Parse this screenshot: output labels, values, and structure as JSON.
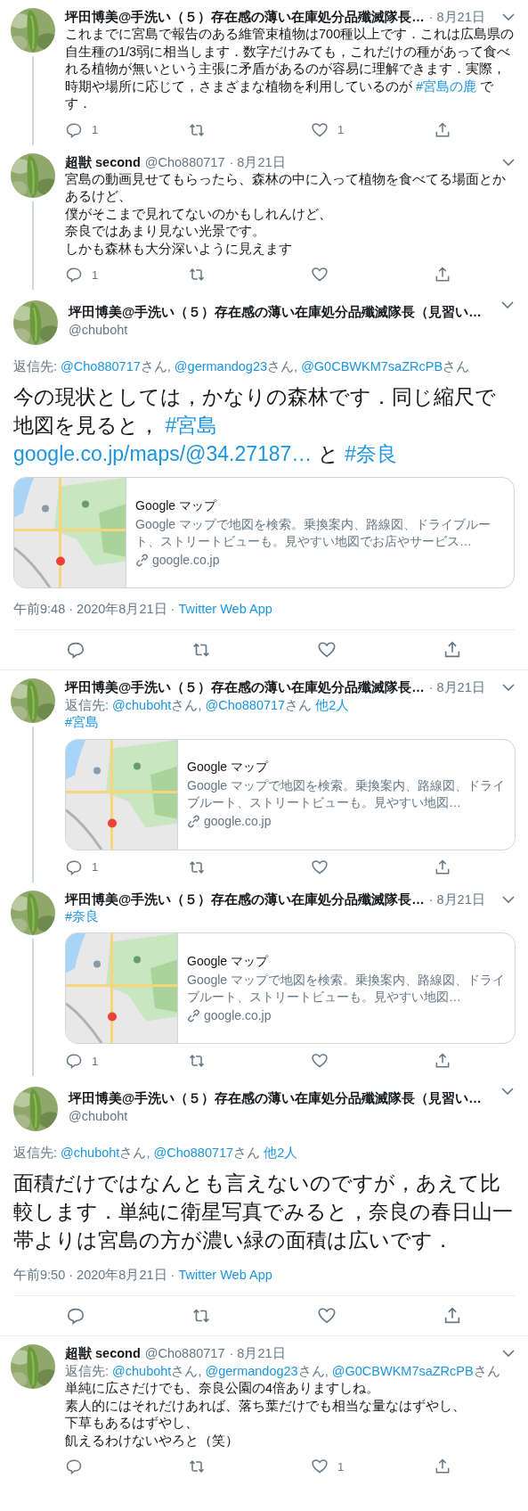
{
  "tweets": [
    {
      "kind": "reply",
      "connected": true,
      "name": "坪田博美@手洗い（５）存在感の薄い在庫処分品殲滅隊長…",
      "date": "· 8月21日",
      "body": [
        [
          {
            "kind": "text",
            "text": "これまでに宮島で報告のある維管束植物は700種以上です．これは広島県の自生種の1/3弱に相当します．数字だけみても，これだけの種があって食べれる植物が無いという主張に矛盾があるのが容易に理解できます．実際，時期や場所に応じて，さまざまな植物を利用しているのが "
          },
          {
            "kind": "link",
            "text": "#宮島の鹿"
          },
          {
            "kind": "text",
            "text": " です．"
          }
        ]
      ],
      "actions": [
        {
          "kind": "reply",
          "count": "1"
        },
        {
          "kind": "retweet"
        },
        {
          "kind": "like",
          "count": "1"
        },
        {
          "kind": "share"
        }
      ]
    },
    {
      "kind": "reply",
      "connected": true,
      "name": "超獣 second",
      "handle": "@Cho880717",
      "date": "· 8月21日",
      "body": [
        [
          {
            "kind": "text",
            "text": "宮島の動画見せてもらったら、森林の中に入って植物を食べてる場面とかあるけど、"
          }
        ],
        [
          {
            "kind": "text",
            "text": "僕がそこまで見れてないのかもしれんけど、"
          }
        ],
        [
          {
            "kind": "text",
            "text": "奈良ではあまり見ない光景です。"
          }
        ],
        [
          {
            "kind": "text",
            "text": "しかも森林も大分深いように見えます"
          }
        ]
      ],
      "actions": [
        {
          "kind": "reply",
          "count": "1"
        },
        {
          "kind": "retweet"
        },
        {
          "kind": "like"
        },
        {
          "kind": "share"
        }
      ]
    },
    {
      "kind": "focused",
      "name": "坪田博美@手洗い（５）存在感の薄い在庫処分品殲滅隊長（見習い…",
      "handle": "@chuboht",
      "reply_to": [
        {
          "kind": "text",
          "text": "返信先: "
        },
        {
          "kind": "link",
          "text": "@Cho880717"
        },
        {
          "kind": "text",
          "text": "さん, "
        },
        {
          "kind": "link",
          "text": "@germandog23"
        },
        {
          "kind": "text",
          "text": "さん, "
        },
        {
          "kind": "link",
          "text": "@G0CBWKM7saZRcPB"
        },
        {
          "kind": "text",
          "text": "さん"
        }
      ],
      "body": [
        [
          {
            "kind": "text",
            "text": "今の現状としては，かなりの森林です．同じ縮尺で地図を見ると， "
          },
          {
            "kind": "link",
            "text": "#宮島"
          }
        ],
        [
          {
            "kind": "link",
            "text": "google.co.jp/maps/@34.27187…"
          },
          {
            "kind": "text",
            "text": " と "
          },
          {
            "kind": "link",
            "text": "#奈良"
          }
        ]
      ],
      "card": {
        "title": "Google マップ",
        "description": "Google マップで地図を検索。乗換案内、路線図、ドライブルート、ストリートビューも。見やすい地図でお店やサービス…",
        "domain": "google.co.jp"
      },
      "meta": {
        "time": "午前9:48 · 2020年8月21日 · ",
        "source": "Twitter Web App"
      },
      "actions": [
        {
          "kind": "reply"
        },
        {
          "kind": "retweet"
        },
        {
          "kind": "like"
        },
        {
          "kind": "share"
        }
      ]
    },
    {
      "kind": "reply",
      "connected": true,
      "name": "坪田博美@手洗い（５）存在感の薄い在庫処分品殲滅隊長…",
      "date": "· 8月21日",
      "reply_to": [
        {
          "kind": "text",
          "text": "返信先: "
        },
        {
          "kind": "link",
          "text": "@chuboht"
        },
        {
          "kind": "text",
          "text": "さん, "
        },
        {
          "kind": "link",
          "text": "@Cho880717"
        },
        {
          "kind": "text",
          "text": "さん "
        },
        {
          "kind": "link",
          "text": "他2人"
        }
      ],
      "body": [
        [
          {
            "kind": "link",
            "text": "#宮島"
          }
        ]
      ],
      "card": {
        "title": "Google マップ",
        "description": "Google マップで地図を検索。乗換案内、路線図、ドライブルート、ストリートビューも。見やすい地図…",
        "domain": "google.co.jp"
      },
      "actions": [
        {
          "kind": "reply",
          "count": "1"
        },
        {
          "kind": "retweet"
        },
        {
          "kind": "like"
        },
        {
          "kind": "share"
        }
      ]
    },
    {
      "kind": "reply",
      "connected": true,
      "name": "坪田博美@手洗い（５）存在感の薄い在庫処分品殲滅隊長…",
      "date": "· 8月21日",
      "body": [
        [
          {
            "kind": "link",
            "text": "#奈良"
          }
        ]
      ],
      "card": {
        "title": "Google マップ",
        "description": "Google マップで地図を検索。乗換案内、路線図、ドライブルート、ストリートビューも。見やすい地図…",
        "domain": "google.co.jp"
      },
      "actions": [
        {
          "kind": "reply",
          "count": "1"
        },
        {
          "kind": "retweet"
        },
        {
          "kind": "like"
        },
        {
          "kind": "share"
        }
      ]
    },
    {
      "kind": "focused",
      "name": "坪田博美@手洗い（５）存在感の薄い在庫処分品殲滅隊長（見習い…",
      "handle": "@chuboht",
      "reply_to": [
        {
          "kind": "text",
          "text": "返信先: "
        },
        {
          "kind": "link",
          "text": "@chuboht"
        },
        {
          "kind": "text",
          "text": "さん, "
        },
        {
          "kind": "link",
          "text": "@Cho880717"
        },
        {
          "kind": "text",
          "text": "さん "
        },
        {
          "kind": "link",
          "text": "他2人"
        }
      ],
      "body": [
        [
          {
            "kind": "text",
            "text": "面積だけではなんとも言えないのですが，あえて比較します．単純に衛星写真でみると，奈良の春日山一帯よりは宮島の方が濃い緑の面積は広いです．"
          }
        ]
      ],
      "meta": {
        "time": "午前9:50 · 2020年8月21日 · ",
        "source": "Twitter Web App"
      },
      "actions": [
        {
          "kind": "reply"
        },
        {
          "kind": "retweet"
        },
        {
          "kind": "like"
        },
        {
          "kind": "share"
        }
      ]
    },
    {
      "kind": "reply",
      "connected": false,
      "name": "超獣 second",
      "handle": "@Cho880717",
      "date": "· 8月21日",
      "reply_to": [
        {
          "kind": "text",
          "text": "返信先: "
        },
        {
          "kind": "link",
          "text": "@chuboht"
        },
        {
          "kind": "text",
          "text": "さん, "
        },
        {
          "kind": "link",
          "text": "@germandog23"
        },
        {
          "kind": "text",
          "text": "さん, "
        },
        {
          "kind": "link",
          "text": "@G0CBWKM7saZRcPB"
        },
        {
          "kind": "text",
          "text": "さん"
        }
      ],
      "body": [
        [
          {
            "kind": "text",
            "text": "単純に広さだけでも、奈良公園の4倍ありますしね。"
          }
        ],
        [
          {
            "kind": "text",
            "text": "素人的にはそれだけあれば、落ち葉だけでも相当な量なはずやし、"
          }
        ],
        [
          {
            "kind": "text",
            "text": "下草もあるはずやし、"
          }
        ],
        [
          {
            "kind": "text",
            "text": "飢えるわけないやろと（笑）"
          }
        ]
      ],
      "actions": [
        {
          "kind": "reply"
        },
        {
          "kind": "retweet"
        },
        {
          "kind": "like",
          "count": "1"
        },
        {
          "kind": "share"
        }
      ]
    }
  ]
}
